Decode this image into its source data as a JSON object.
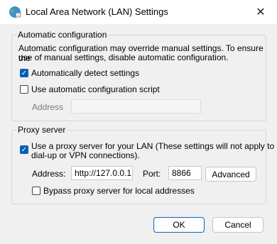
{
  "window": {
    "title": "Local Area Network (LAN) Settings",
    "close_glyph": "✕"
  },
  "auto_config": {
    "group_label": "Automatic configuration",
    "description_line1": "Automatic configuration may override manual settings.  To ensure the",
    "description_line2": "use of manual settings, disable automatic configuration.",
    "detect": {
      "label": "Automatically detect settings",
      "checked": true
    },
    "script": {
      "label": "Use automatic configuration script",
      "checked": false
    },
    "address_label": "Address",
    "address_value": ""
  },
  "proxy": {
    "group_label": "Proxy server",
    "use_proxy": {
      "label_line1": "Use a proxy server for your LAN (These settings will not apply to",
      "label_line2": "dial-up or VPN connections).",
      "checked": true
    },
    "address_label": "Address:",
    "address_value": "http://127.0.0.1",
    "port_label": "Port:",
    "port_value": "8866",
    "advanced_label": "Advanced",
    "bypass": {
      "label": "Bypass proxy server for local addresses",
      "checked": false
    }
  },
  "buttons": {
    "ok": "OK",
    "cancel": "Cancel"
  },
  "colors": {
    "accent": "#005fb8",
    "background": "#f0f0f0"
  }
}
